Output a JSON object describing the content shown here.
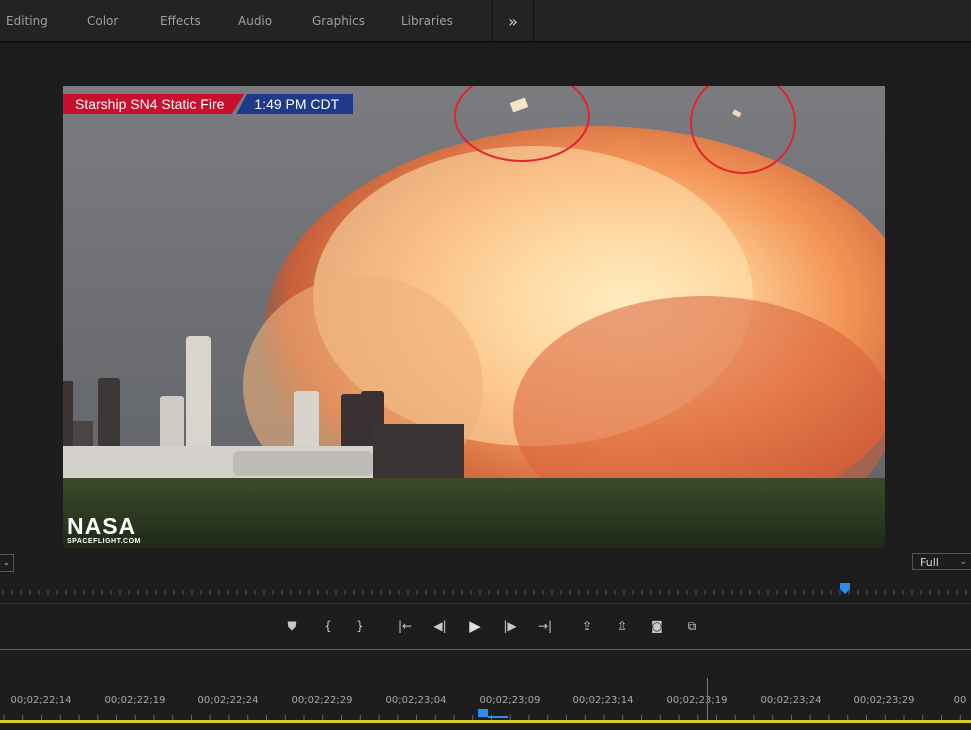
{
  "workspace_tabs": [
    {
      "label": "Editing"
    },
    {
      "label": "Color"
    },
    {
      "label": "Effects"
    },
    {
      "label": "Audio"
    },
    {
      "label": "Graphics"
    },
    {
      "label": "Libraries"
    }
  ],
  "more_glyph": "»",
  "video": {
    "lower_third_title": "Starship SN4 Static Fire",
    "lower_third_time": "1:49 PM CDT",
    "logo_main": "NASA",
    "logo_sub": "SPACEFLIGHT.COM",
    "annotation_color": "#e3232f"
  },
  "monitor": {
    "zoom_arrow": "⌄",
    "resolution": "Full",
    "resolution_arrow": "⌄"
  },
  "transport": [
    {
      "name": "add-marker",
      "glyph": "⛊"
    },
    {
      "name": "mark-in",
      "glyph": "{"
    },
    {
      "name": "mark-out",
      "glyph": "}"
    },
    {
      "name": "go-to-in",
      "glyph": "|←"
    },
    {
      "name": "step-back",
      "glyph": "◀|"
    },
    {
      "name": "play",
      "glyph": "▶"
    },
    {
      "name": "step-forward",
      "glyph": "|▶"
    },
    {
      "name": "go-to-out",
      "glyph": "→|"
    },
    {
      "name": "lift",
      "glyph": "⇪"
    },
    {
      "name": "extract",
      "glyph": "⇫"
    },
    {
      "name": "export-frame",
      "glyph": "◙"
    },
    {
      "name": "comparison-view",
      "glyph": "⧉"
    }
  ],
  "timeline": {
    "timecodes": [
      "00;02;22;14",
      "00;02;22;19",
      "00;02;22;24",
      "00;02;22;29",
      "00;02;23;04",
      "00;02;23;09",
      "00;02;23;14",
      "00;02;23;19",
      "00;02;23;24",
      "00;02;23;29",
      "00"
    ]
  },
  "colors": {
    "accent_blue": "#2d8cf0",
    "work_area": "#d6cc2c"
  }
}
